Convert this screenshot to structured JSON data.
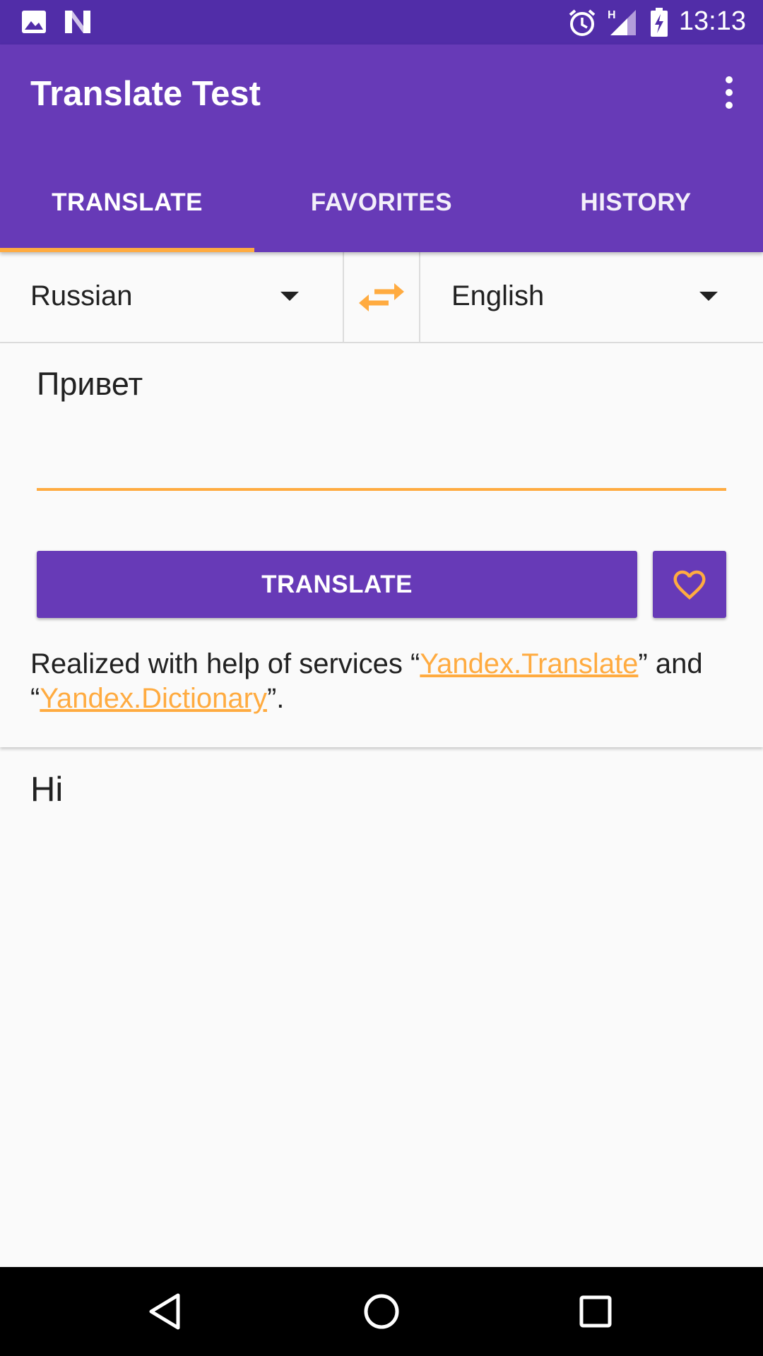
{
  "status_bar": {
    "time": "13:13",
    "icons": [
      "image-icon",
      "n-logo-icon",
      "alarm-icon",
      "signal-h-icon",
      "battery-charging-icon"
    ]
  },
  "app_bar": {
    "title": "Translate Test",
    "menu_icon": "more-vert-icon"
  },
  "tabs": [
    {
      "label": "TRANSLATE",
      "active": true
    },
    {
      "label": "FAVORITES",
      "active": false
    },
    {
      "label": "HISTORY",
      "active": false
    }
  ],
  "languages": {
    "source": "Russian",
    "target": "English",
    "swap_icon": "swap-horiz-icon"
  },
  "input": {
    "value": "Привет"
  },
  "translate_button": {
    "label": "TRANSLATE"
  },
  "favorite_button": {
    "icon": "heart-outline-icon"
  },
  "attribution": {
    "prefix": "Realized with help of services “",
    "link1": "Yandex.Translate",
    "middle": "” and “",
    "link2": "Yandex.Dictionary",
    "suffix": "”."
  },
  "result": {
    "text": "Hi"
  },
  "nav_bar": {
    "icons": [
      "back-icon",
      "home-icon",
      "recents-icon"
    ]
  },
  "colors": {
    "status_bar": "#512da8",
    "primary": "#673ab7",
    "accent": "#ffab40",
    "background": "#fafafa",
    "text": "#212121"
  }
}
